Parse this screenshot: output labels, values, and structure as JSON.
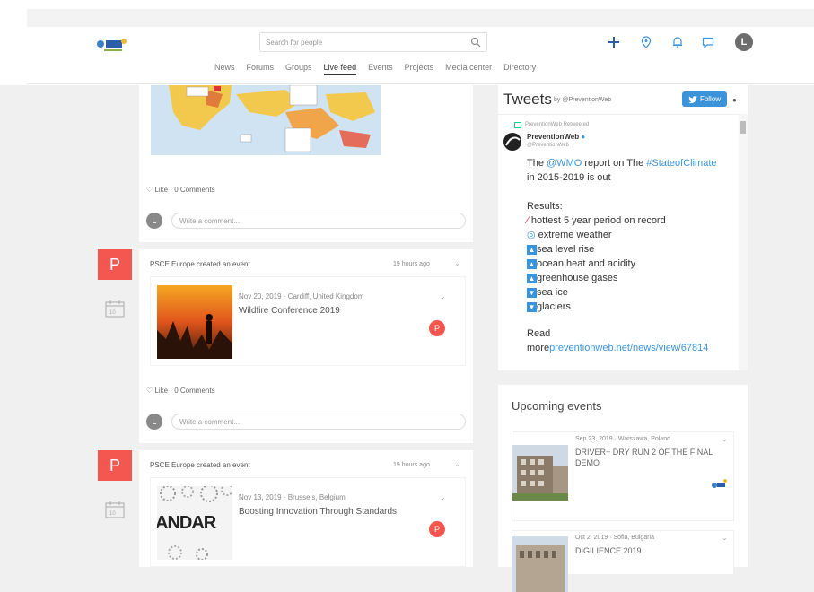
{
  "header": {
    "search_placeholder": "Search for people",
    "avatar_letter": "L",
    "nav": [
      "News",
      "Forums",
      "Groups",
      "Live feed",
      "Events",
      "Projects",
      "Media center",
      "Directory"
    ],
    "nav_active": "Live feed"
  },
  "feed": {
    "first_post": {
      "like_label": "Like",
      "comments_label": "0 Comments",
      "comment_avatar": "L",
      "comment_placeholder": "Write a comment..."
    },
    "posts": [
      {
        "avatar_letter": "P",
        "meta": "PSCE Europe created an event",
        "time": "19 hours ago",
        "event_date": "Nov 20, 2019",
        "event_location": "Cardiff, United Kingdom",
        "event_title": "Wildfire Conference 2019",
        "badge": "P",
        "calendar_day": "10",
        "like_label": "Like",
        "comments_label": "0 Comments",
        "comment_avatar": "L",
        "comment_placeholder": "Write a comment..."
      },
      {
        "avatar_letter": "P",
        "meta": "PSCE Europe created an event",
        "time": "19 hours ago",
        "event_date": "Nov 13, 2019",
        "event_location": "Brussels, Belgium",
        "event_title": "Boosting Innovation Through Standards",
        "thumb_text": "ANDAR",
        "badge": "P",
        "calendar_day": "10"
      }
    ]
  },
  "tweets": {
    "title": "Tweets",
    "by": "by @PreventionWeb",
    "follow": "Follow",
    "info": "i",
    "retweeted": "PreventionWeb Retweeted",
    "user": "PreventionWeb",
    "handle": "@PreventionWeb",
    "line1_pre": "The ",
    "line1_link1": "@WMO",
    "line1_mid": " report on The ",
    "line1_link2": "#StateofClimate",
    "line2": "in 2015-2019 is out",
    "results": "Results:",
    "items": [
      "hottest 5 year period on record",
      "extreme weather",
      "sea level rise",
      "ocean heat and acidity",
      "greenhouse gases",
      "sea ice",
      "glaciers"
    ],
    "read": "Read",
    "more": "more",
    "more_link": "preventionweb.net/news/view/67814",
    "colors": {
      "link": "#3b94d9",
      "follow": "#3b94d9"
    }
  },
  "upcoming": {
    "title": "Upcoming events",
    "events": [
      {
        "date": "Sep 23, 2019",
        "location": "Warszawa, Poland",
        "name": "DRIVER+ DRY RUN 2 OF THE FINAL DEMO"
      },
      {
        "date": "Oct 2, 2019",
        "location": "Sofia, Bulgaria",
        "name": "DIGILIENCE 2019"
      }
    ]
  },
  "colors": {
    "accent_red": "#f4574f",
    "blue": "#3b94d9"
  }
}
